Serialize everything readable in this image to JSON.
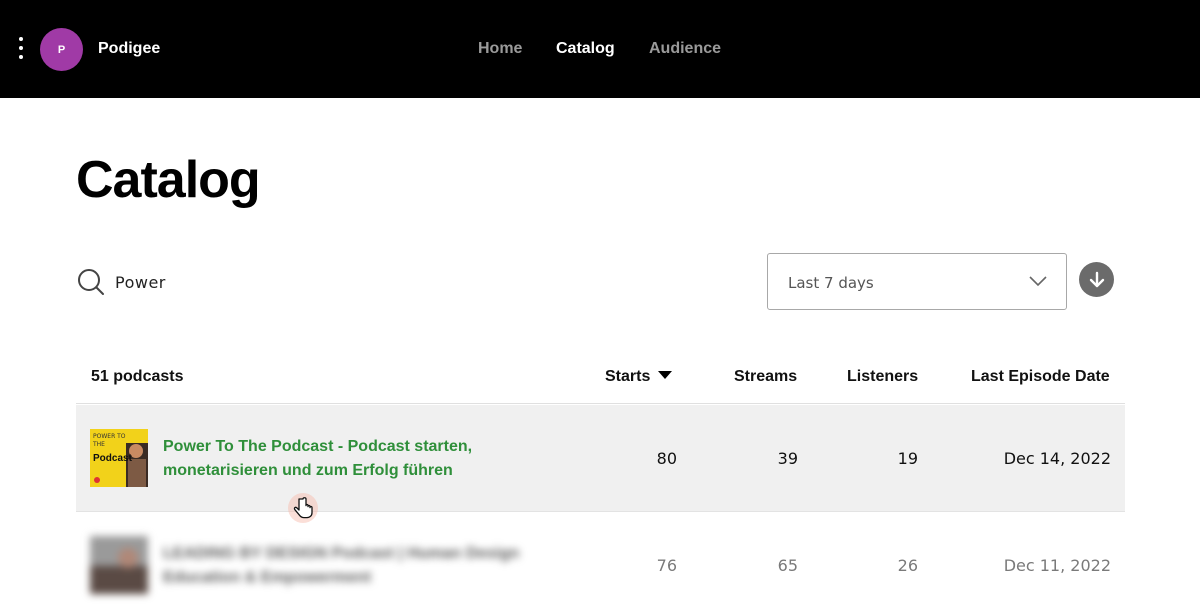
{
  "header": {
    "brand": "Podigee",
    "avatar_initial": "P",
    "avatar_color": "#a03aa6",
    "nav": [
      {
        "label": "Home",
        "active": false
      },
      {
        "label": "Catalog",
        "active": true
      },
      {
        "label": "Audience",
        "active": false
      }
    ]
  },
  "page": {
    "title": "Catalog"
  },
  "search": {
    "value": "Power",
    "icon": "search-icon"
  },
  "filters": {
    "date_range": "Last 7 days"
  },
  "table": {
    "count_label": "51 podcasts",
    "columns": {
      "starts": "Starts",
      "streams": "Streams",
      "listeners": "Listeners",
      "last_episode": "Last Episode Date"
    },
    "sorted_by": "Starts",
    "rows": [
      {
        "title": "Power To The Podcast - Podcast starten, monetarisieren und zum Erfolg führen",
        "thumb_text": "POWER TO THE Podcast",
        "starts": "80",
        "streams": "39",
        "listeners": "19",
        "last_episode": "Dec 14, 2022"
      },
      {
        "title": "LEADING BY DESIGN Podcast | Human Design Education & Empowerment",
        "starts": "76",
        "streams": "65",
        "listeners": "26",
        "last_episode": "Dec 11, 2022"
      }
    ]
  },
  "colors": {
    "accent_green": "#2f8f3a",
    "topbar": "#000000"
  }
}
